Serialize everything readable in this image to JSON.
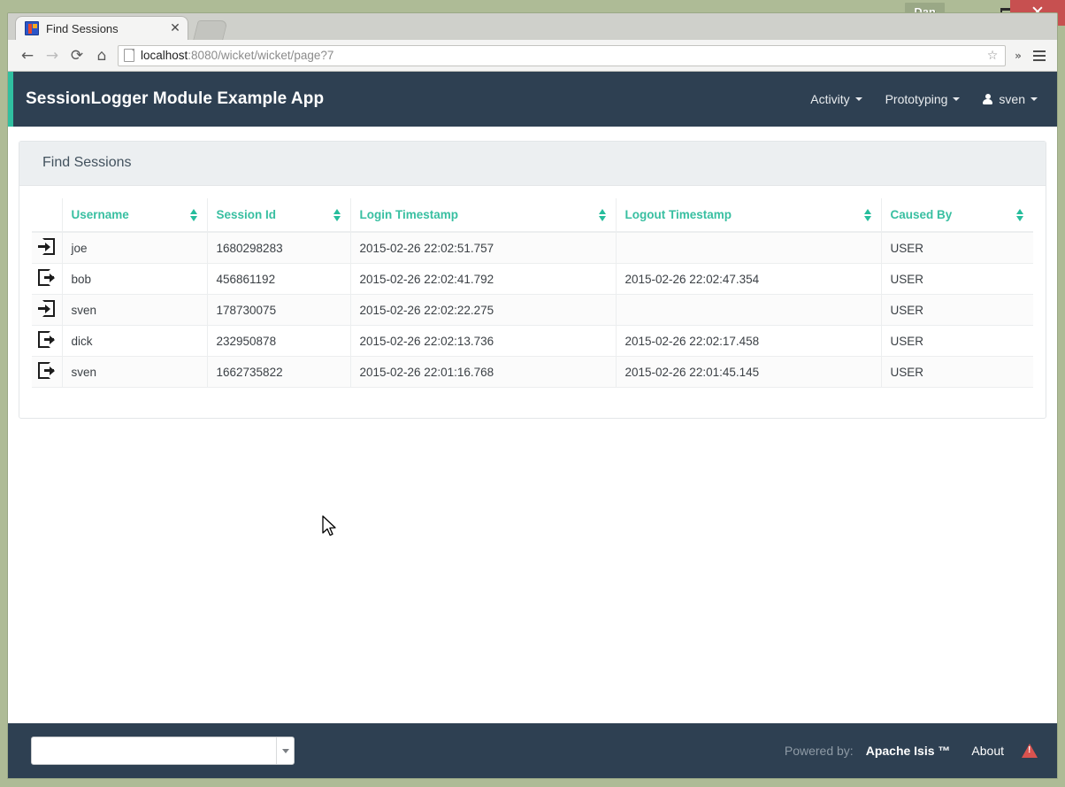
{
  "os": {
    "user_button": "Dan",
    "minimize_icon": "minimize-icon",
    "maximize_icon": "maximize-icon",
    "close_icon": "close-icon"
  },
  "browser": {
    "tab": {
      "title": "Find Sessions",
      "favicon": "app-favicon",
      "close_icon": "tab-close-icon"
    },
    "new_tab_icon": "new-tab-icon",
    "back_icon": "←",
    "forward_icon": "→",
    "reload_icon": "⟳",
    "home_icon": "⌂",
    "url_host": "localhost",
    "url_rest": ":8080/wicket/wicket/page?7",
    "bookmark_icon": "☆",
    "overflow_icon": "»",
    "menu_icon": "hamburger-menu-icon"
  },
  "navbar": {
    "brand": "SessionLogger Module Example App",
    "items": [
      {
        "label": "Activity",
        "has_caret": true
      },
      {
        "label": "Prototyping",
        "has_caret": true
      }
    ],
    "user": {
      "label": "sven",
      "has_caret": true,
      "icon": "user-icon"
    },
    "accent_color": "#30bfa0",
    "background_color": "#2e4052"
  },
  "page": {
    "title": "Find Sessions"
  },
  "table": {
    "columns": [
      {
        "label": "",
        "key": "icon",
        "sortable": false
      },
      {
        "label": "Username",
        "key": "username",
        "sortable": true
      },
      {
        "label": "Session Id",
        "key": "session_id",
        "sortable": true
      },
      {
        "label": "Login Timestamp",
        "key": "login",
        "sortable": true
      },
      {
        "label": "Logout Timestamp",
        "key": "logout",
        "sortable": true
      },
      {
        "label": "Caused By",
        "key": "caused_by",
        "sortable": true
      }
    ],
    "rows": [
      {
        "icon": "sign-in-icon",
        "username": "joe",
        "session_id": "1680298283",
        "login": "2015-02-26 22:02:51.757",
        "logout": "",
        "caused_by": "USER"
      },
      {
        "icon": "sign-out-icon",
        "username": "bob",
        "session_id": "456861192",
        "login": "2015-02-26 22:02:41.792",
        "logout": "2015-02-26 22:02:47.354",
        "caused_by": "USER"
      },
      {
        "icon": "sign-in-icon",
        "username": "sven",
        "session_id": "178730075",
        "login": "2015-02-26 22:02:22.275",
        "logout": "",
        "caused_by": "USER"
      },
      {
        "icon": "sign-out-icon",
        "username": "dick",
        "session_id": "232950878",
        "login": "2015-02-26 22:02:13.736",
        "logout": "2015-02-26 22:02:17.458",
        "caused_by": "USER"
      },
      {
        "icon": "sign-out-icon",
        "username": "sven",
        "session_id": "1662735822",
        "login": "2015-02-26 22:01:16.768",
        "logout": "2015-02-26 22:01:45.145",
        "caused_by": "USER"
      }
    ],
    "header_color": "#38bfa1"
  },
  "footer": {
    "select_value": "",
    "select_caret_icon": "chevron-down-icon",
    "powered_by_label": "Powered by:",
    "product": "Apache Isis ™",
    "about": "About",
    "warning_icon": "warning-icon"
  }
}
